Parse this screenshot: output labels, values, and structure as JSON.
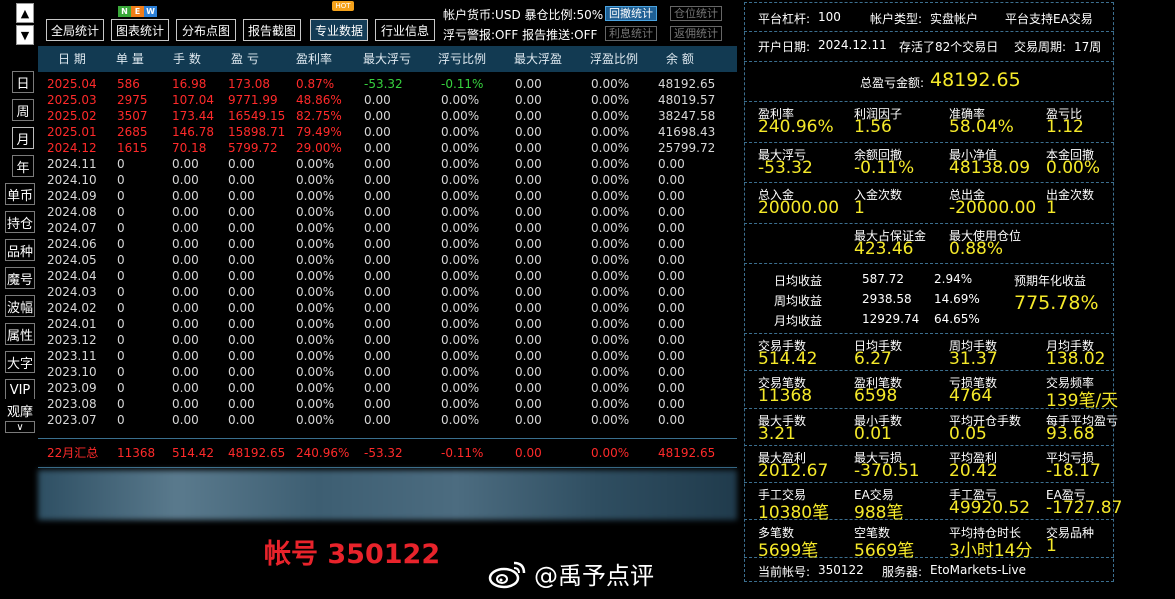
{
  "toolbar": {
    "buttons": [
      "全局统计",
      "图表统计",
      "分布点图",
      "报告截图",
      "专业数据",
      "行业信息"
    ],
    "badge_new": [
      "N",
      "E",
      "W"
    ],
    "badge_hot": "HOT",
    "account_currency": "帐户货币:USD 暴仓比例:50%",
    "alerts": "浮亏警报:OFF 报告推送:OFF",
    "small_buttons": [
      "回撤统计",
      "仓位统计",
      "利息统计",
      "返佣统计"
    ]
  },
  "side_tabs": [
    "日",
    "周",
    "月",
    "年",
    "单币",
    "持仓",
    "品种",
    "魔号",
    "波幅",
    "属性",
    "大字",
    "VIP",
    "观摩"
  ],
  "table": {
    "headers": [
      "日 期",
      "单 量",
      "手 数",
      "盈 亏",
      "盈利率",
      "最大浮亏",
      "浮亏比例",
      "最大浮盈",
      "浮盈比例",
      "余 额"
    ],
    "rows": [
      [
        "2025.04",
        "586",
        "16.98",
        "173.08",
        "0.87%",
        "-53.32",
        "-0.11%",
        "0.00",
        "0.00%",
        "48192.65"
      ],
      [
        "2025.03",
        "2975",
        "107.04",
        "9771.99",
        "48.86%",
        "0.00",
        "0.00%",
        "0.00",
        "0.00%",
        "48019.57"
      ],
      [
        "2025.02",
        "3507",
        "173.44",
        "16549.15",
        "82.75%",
        "0.00",
        "0.00%",
        "0.00",
        "0.00%",
        "38247.58"
      ],
      [
        "2025.01",
        "2685",
        "146.78",
        "15898.71",
        "79.49%",
        "0.00",
        "0.00%",
        "0.00",
        "0.00%",
        "41698.43"
      ],
      [
        "2024.12",
        "1615",
        "70.18",
        "5799.72",
        "29.00%",
        "0.00",
        "0.00%",
        "0.00",
        "0.00%",
        "25799.72"
      ],
      [
        "2024.11",
        "0",
        "0.00",
        "0.00",
        "0.00%",
        "0.00",
        "0.00%",
        "0.00",
        "0.00%",
        "0.00"
      ],
      [
        "2024.10",
        "0",
        "0.00",
        "0.00",
        "0.00%",
        "0.00",
        "0.00%",
        "0.00",
        "0.00%",
        "0.00"
      ],
      [
        "2024.09",
        "0",
        "0.00",
        "0.00",
        "0.00%",
        "0.00",
        "0.00%",
        "0.00",
        "0.00%",
        "0.00"
      ],
      [
        "2024.08",
        "0",
        "0.00",
        "0.00",
        "0.00%",
        "0.00",
        "0.00%",
        "0.00",
        "0.00%",
        "0.00"
      ],
      [
        "2024.07",
        "0",
        "0.00",
        "0.00",
        "0.00%",
        "0.00",
        "0.00%",
        "0.00",
        "0.00%",
        "0.00"
      ],
      [
        "2024.06",
        "0",
        "0.00",
        "0.00",
        "0.00%",
        "0.00",
        "0.00%",
        "0.00",
        "0.00%",
        "0.00"
      ],
      [
        "2024.05",
        "0",
        "0.00",
        "0.00",
        "0.00%",
        "0.00",
        "0.00%",
        "0.00",
        "0.00%",
        "0.00"
      ],
      [
        "2024.04",
        "0",
        "0.00",
        "0.00",
        "0.00%",
        "0.00",
        "0.00%",
        "0.00",
        "0.00%",
        "0.00"
      ],
      [
        "2024.03",
        "0",
        "0.00",
        "0.00",
        "0.00%",
        "0.00",
        "0.00%",
        "0.00",
        "0.00%",
        "0.00"
      ],
      [
        "2024.02",
        "0",
        "0.00",
        "0.00",
        "0.00%",
        "0.00",
        "0.00%",
        "0.00",
        "0.00%",
        "0.00"
      ],
      [
        "2024.01",
        "0",
        "0.00",
        "0.00",
        "0.00%",
        "0.00",
        "0.00%",
        "0.00",
        "0.00%",
        "0.00"
      ],
      [
        "2023.12",
        "0",
        "0.00",
        "0.00",
        "0.00%",
        "0.00",
        "0.00%",
        "0.00",
        "0.00%",
        "0.00"
      ],
      [
        "2023.11",
        "0",
        "0.00",
        "0.00",
        "0.00%",
        "0.00",
        "0.00%",
        "0.00",
        "0.00%",
        "0.00"
      ],
      [
        "2023.10",
        "0",
        "0.00",
        "0.00",
        "0.00%",
        "0.00",
        "0.00%",
        "0.00",
        "0.00%",
        "0.00"
      ],
      [
        "2023.09",
        "0",
        "0.00",
        "0.00",
        "0.00%",
        "0.00",
        "0.00%",
        "0.00",
        "0.00%",
        "0.00"
      ],
      [
        "2023.08",
        "0",
        "0.00",
        "0.00",
        "0.00%",
        "0.00",
        "0.00%",
        "0.00",
        "0.00%",
        "0.00"
      ],
      [
        "2023.07",
        "0",
        "0.00",
        "0.00",
        "0.00%",
        "0.00",
        "0.00%",
        "0.00",
        "0.00%",
        "0.00"
      ]
    ],
    "summary": [
      "22月汇总",
      "11368",
      "514.42",
      "48192.65",
      "240.96%",
      "-53.32",
      "-0.11%",
      "0.00",
      "0.00%",
      "48192.65"
    ]
  },
  "watermark": {
    "account": "帐号 350122",
    "weibo": "@禹予点评"
  },
  "right": {
    "top1": [
      "平台杠杆:",
      "100",
      "帐户类型:",
      "实盘帐户",
      "平台支持EA交易"
    ],
    "top2": [
      "开户日期:",
      "2024.12.11",
      "存活了82个交易日",
      "交易周期:",
      "17周"
    ],
    "total_label": "总盈亏金额:",
    "total_value": "48192.65",
    "grid1": [
      [
        "盈利率",
        "240.96%"
      ],
      [
        "利润因子",
        "1.56"
      ],
      [
        "准确率",
        "58.04%"
      ],
      [
        "盈亏比",
        "1.12"
      ],
      [
        "最大浮亏",
        "-53.32"
      ],
      [
        "余额回撤",
        "-0.11%"
      ],
      [
        "最小净值",
        "48138.09"
      ],
      [
        "本金回撤",
        "0.00%"
      ],
      [
        "总入金",
        "20000.00"
      ],
      [
        "入金次数",
        "1"
      ],
      [
        "总出金",
        "-20000.00"
      ],
      [
        "出金次数",
        "1"
      ],
      [
        "最大占保证金",
        "423.46"
      ],
      [
        "最大使用仓位",
        "0.88%"
      ]
    ],
    "avg": [
      [
        "日均收益",
        "587.72",
        "2.94%"
      ],
      [
        "周均收益",
        "2938.58",
        "14.69%"
      ],
      [
        "月均收益",
        "12929.74",
        "64.65%"
      ]
    ],
    "annual_label": "预期年化收益",
    "annual_value": "775.78%",
    "grid2": [
      [
        "交易手数",
        "514.42"
      ],
      [
        "日均手数",
        "6.27"
      ],
      [
        "周均手数",
        "31.37"
      ],
      [
        "月均手数",
        "138.02"
      ],
      [
        "交易笔数",
        "11368"
      ],
      [
        "盈利笔数",
        "6598"
      ],
      [
        "亏损笔数",
        "4764"
      ],
      [
        "交易频率",
        "139笔/天"
      ],
      [
        "最大手数",
        "3.21"
      ],
      [
        "最小手数",
        "0.01"
      ],
      [
        "平均开仓手数",
        "0.05"
      ],
      [
        "每手平均盈亏",
        "93.68"
      ],
      [
        "最大盈利",
        "2012.67"
      ],
      [
        "最大亏损",
        "-370.51"
      ],
      [
        "平均盈利",
        "20.42"
      ],
      [
        "平均亏损",
        "-18.17"
      ],
      [
        "手工交易",
        "10380笔"
      ],
      [
        "EA交易",
        "988笔"
      ],
      [
        "手工盈亏",
        "49920.52"
      ],
      [
        "EA盈亏",
        "-1727.87"
      ],
      [
        "多笔数",
        "5699笔"
      ],
      [
        "空笔数",
        "5669笔"
      ],
      [
        "平均持仓时长",
        "3小时14分"
      ],
      [
        "交易品种",
        "1"
      ]
    ],
    "footer": [
      "当前帐号:",
      "350122",
      "服务器:",
      "EtoMarkets-Live"
    ]
  }
}
